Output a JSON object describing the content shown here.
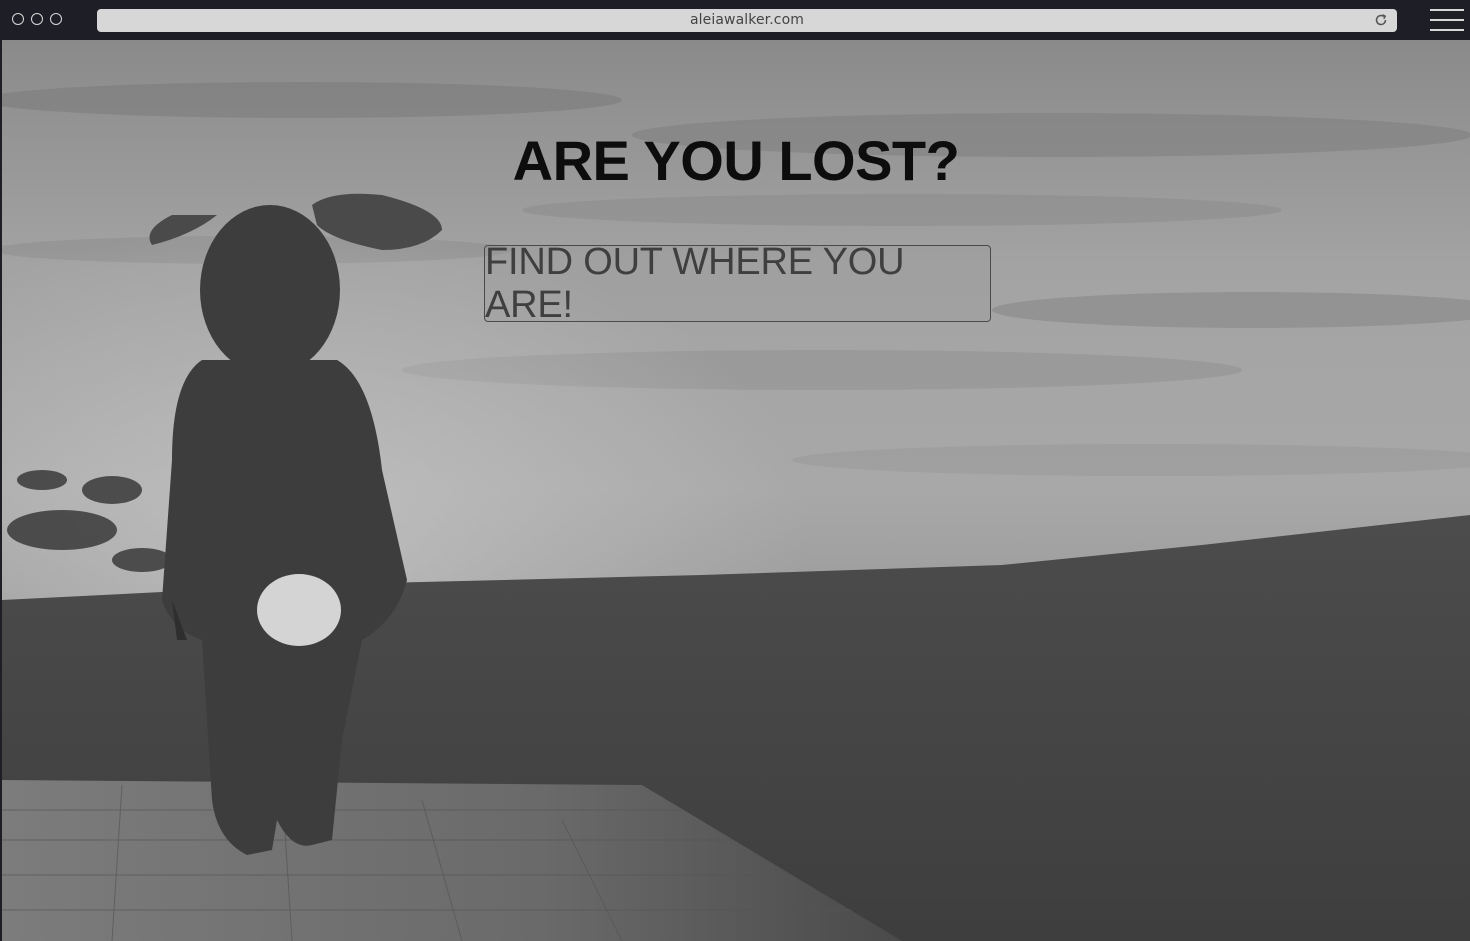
{
  "browser": {
    "url": "aleiawalker.com"
  },
  "page": {
    "headline": "ARE YOU LOST?",
    "cta_label": "FIND OUT WHERE YOU ARE!",
    "background_image": "person-in-bunny-costume-walking-at-dusk"
  },
  "colors": {
    "chrome": "#1e1f26",
    "headline": "#0d0d0d",
    "cta_text": "#3f3f3f"
  }
}
